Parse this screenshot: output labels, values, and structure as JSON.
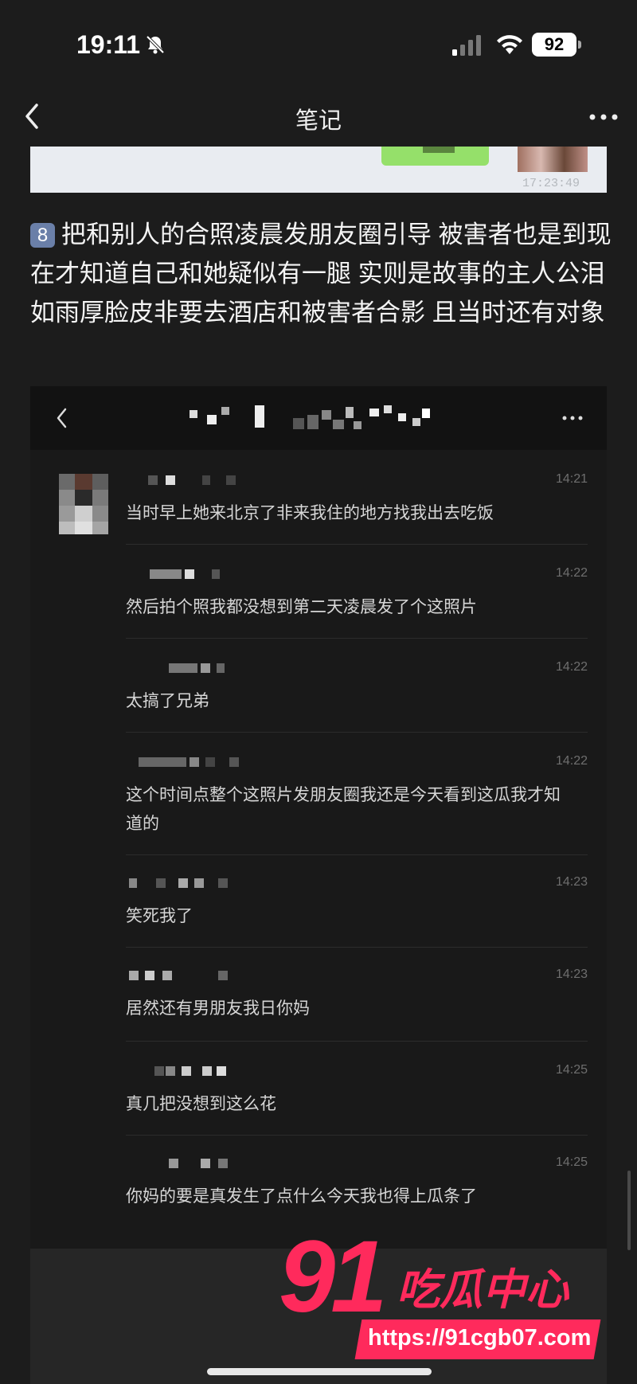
{
  "status_bar": {
    "time": "19:11",
    "battery": "92",
    "icons": [
      "bell-slash-icon",
      "signal-icon",
      "wifi-icon",
      "battery-icon"
    ]
  },
  "navbar": {
    "title": "笔记",
    "back_icon": "chevron-left-icon",
    "more_icon": "more-dots-icon"
  },
  "prev_image": {
    "timestamp": "17:23:49"
  },
  "paragraph": {
    "number": "8",
    "text": "把和别人的合照凌晨发朋友圈引导 被害者也是到现在才知道自己和她疑似有一腿 实则是故事的主人公泪如雨厚脸皮非要去酒店和被害者合影 且当时还有对象"
  },
  "chat_screenshot": {
    "messages": [
      {
        "time": "14:21",
        "text": "当时早上她来北京了非来我住的地方找我出去吃饭"
      },
      {
        "time": "14:22",
        "text": "然后拍个照我都没想到第二天凌晨发了个这照片"
      },
      {
        "time": "14:22",
        "text": "太搞了兄弟"
      },
      {
        "time": "14:22",
        "text": "这个时间点整个这照片发朋友圈我还是今天看到这瓜我才知道的"
      },
      {
        "time": "14:23",
        "text": "笑死我了"
      },
      {
        "time": "14:23",
        "text": "居然还有男朋友我日你妈"
      },
      {
        "time": "14:25",
        "text": "真几把没想到这么花"
      },
      {
        "time": "14:25",
        "text": "你妈的要是真发生了点什么今天我也得上瓜条了"
      }
    ]
  },
  "watermark": {
    "big": "91",
    "cn": "吃瓜中心",
    "url": "https://91cgb07.com"
  },
  "colors": {
    "background": "#1c1c1c",
    "accent": "#ff2a5c",
    "green_button": "#95e06a"
  }
}
